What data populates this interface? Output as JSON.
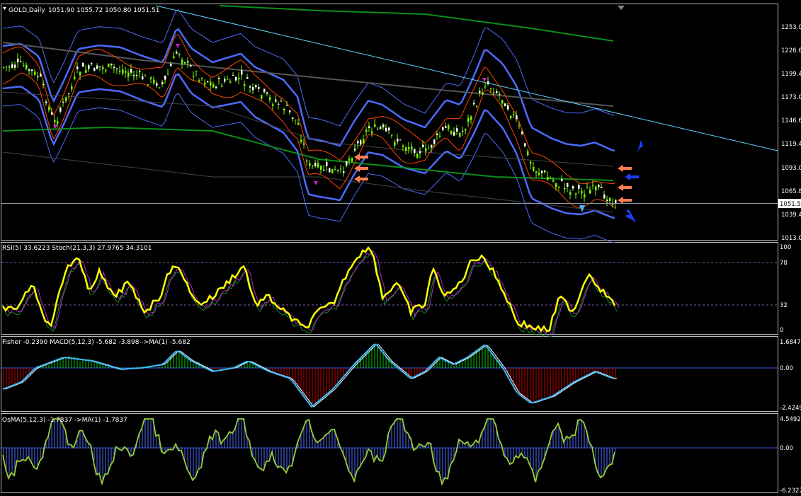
{
  "header": {
    "symbol": "GOLD,Daily",
    "ohlc": "1051.90 1055.72 1050.80 1051.51"
  },
  "price_pane": {
    "ticks": [
      "1253.0",
      "1226.6",
      "1199.4",
      "1173.0",
      "1146.6",
      "1119.4",
      "1093.0",
      "1065.8",
      "1039.4",
      "1013.0"
    ],
    "current_price": "1051.5",
    "colors": {
      "bull": "#7cfc00",
      "bear": "#ffffff",
      "bb_outer": "#4d6bff",
      "bb_mid": "#3b5bdb",
      "envelope": "#ff4500",
      "ma_green": "#0a8f1a",
      "trend": "#5fd4ff"
    }
  },
  "rsi_pane": {
    "title": "RSI(5) 33.6223  Stoch(21,3,3) 27.9765 34.3101",
    "ticks": [
      "100",
      "78",
      "32",
      "0"
    ],
    "colors": {
      "rsi": "#ffff00",
      "stoch_main": "#0a8f1a",
      "stoch_signal": "#b22dbb"
    }
  },
  "macd_pane": {
    "title": "Fisher -0.2390  MACD(5,12,3) -5.682 -3.898  ->MA(1) -5.682",
    "ticks": [
      "1.6847",
      "0.00",
      "-2.4249"
    ],
    "colors": {
      "pos": "#00cc00",
      "neg": "#cc0000",
      "line": "#3bb8ff",
      "signal": "#ffffff"
    }
  },
  "osma_pane": {
    "title": "OsMA(5,12,3) -1.7837  ->MA(1) -1.7837",
    "ticks": [
      "4.5492",
      "0.00",
      "-6.2327"
    ],
    "colors": {
      "line": "#9acd32",
      "hist": "#4d6bff"
    }
  },
  "arrows": {
    "orange": "#ff7f50",
    "blue": "#1e3cff",
    "cyan": "#3bb8ff",
    "magenta": "#d020d0"
  }
}
